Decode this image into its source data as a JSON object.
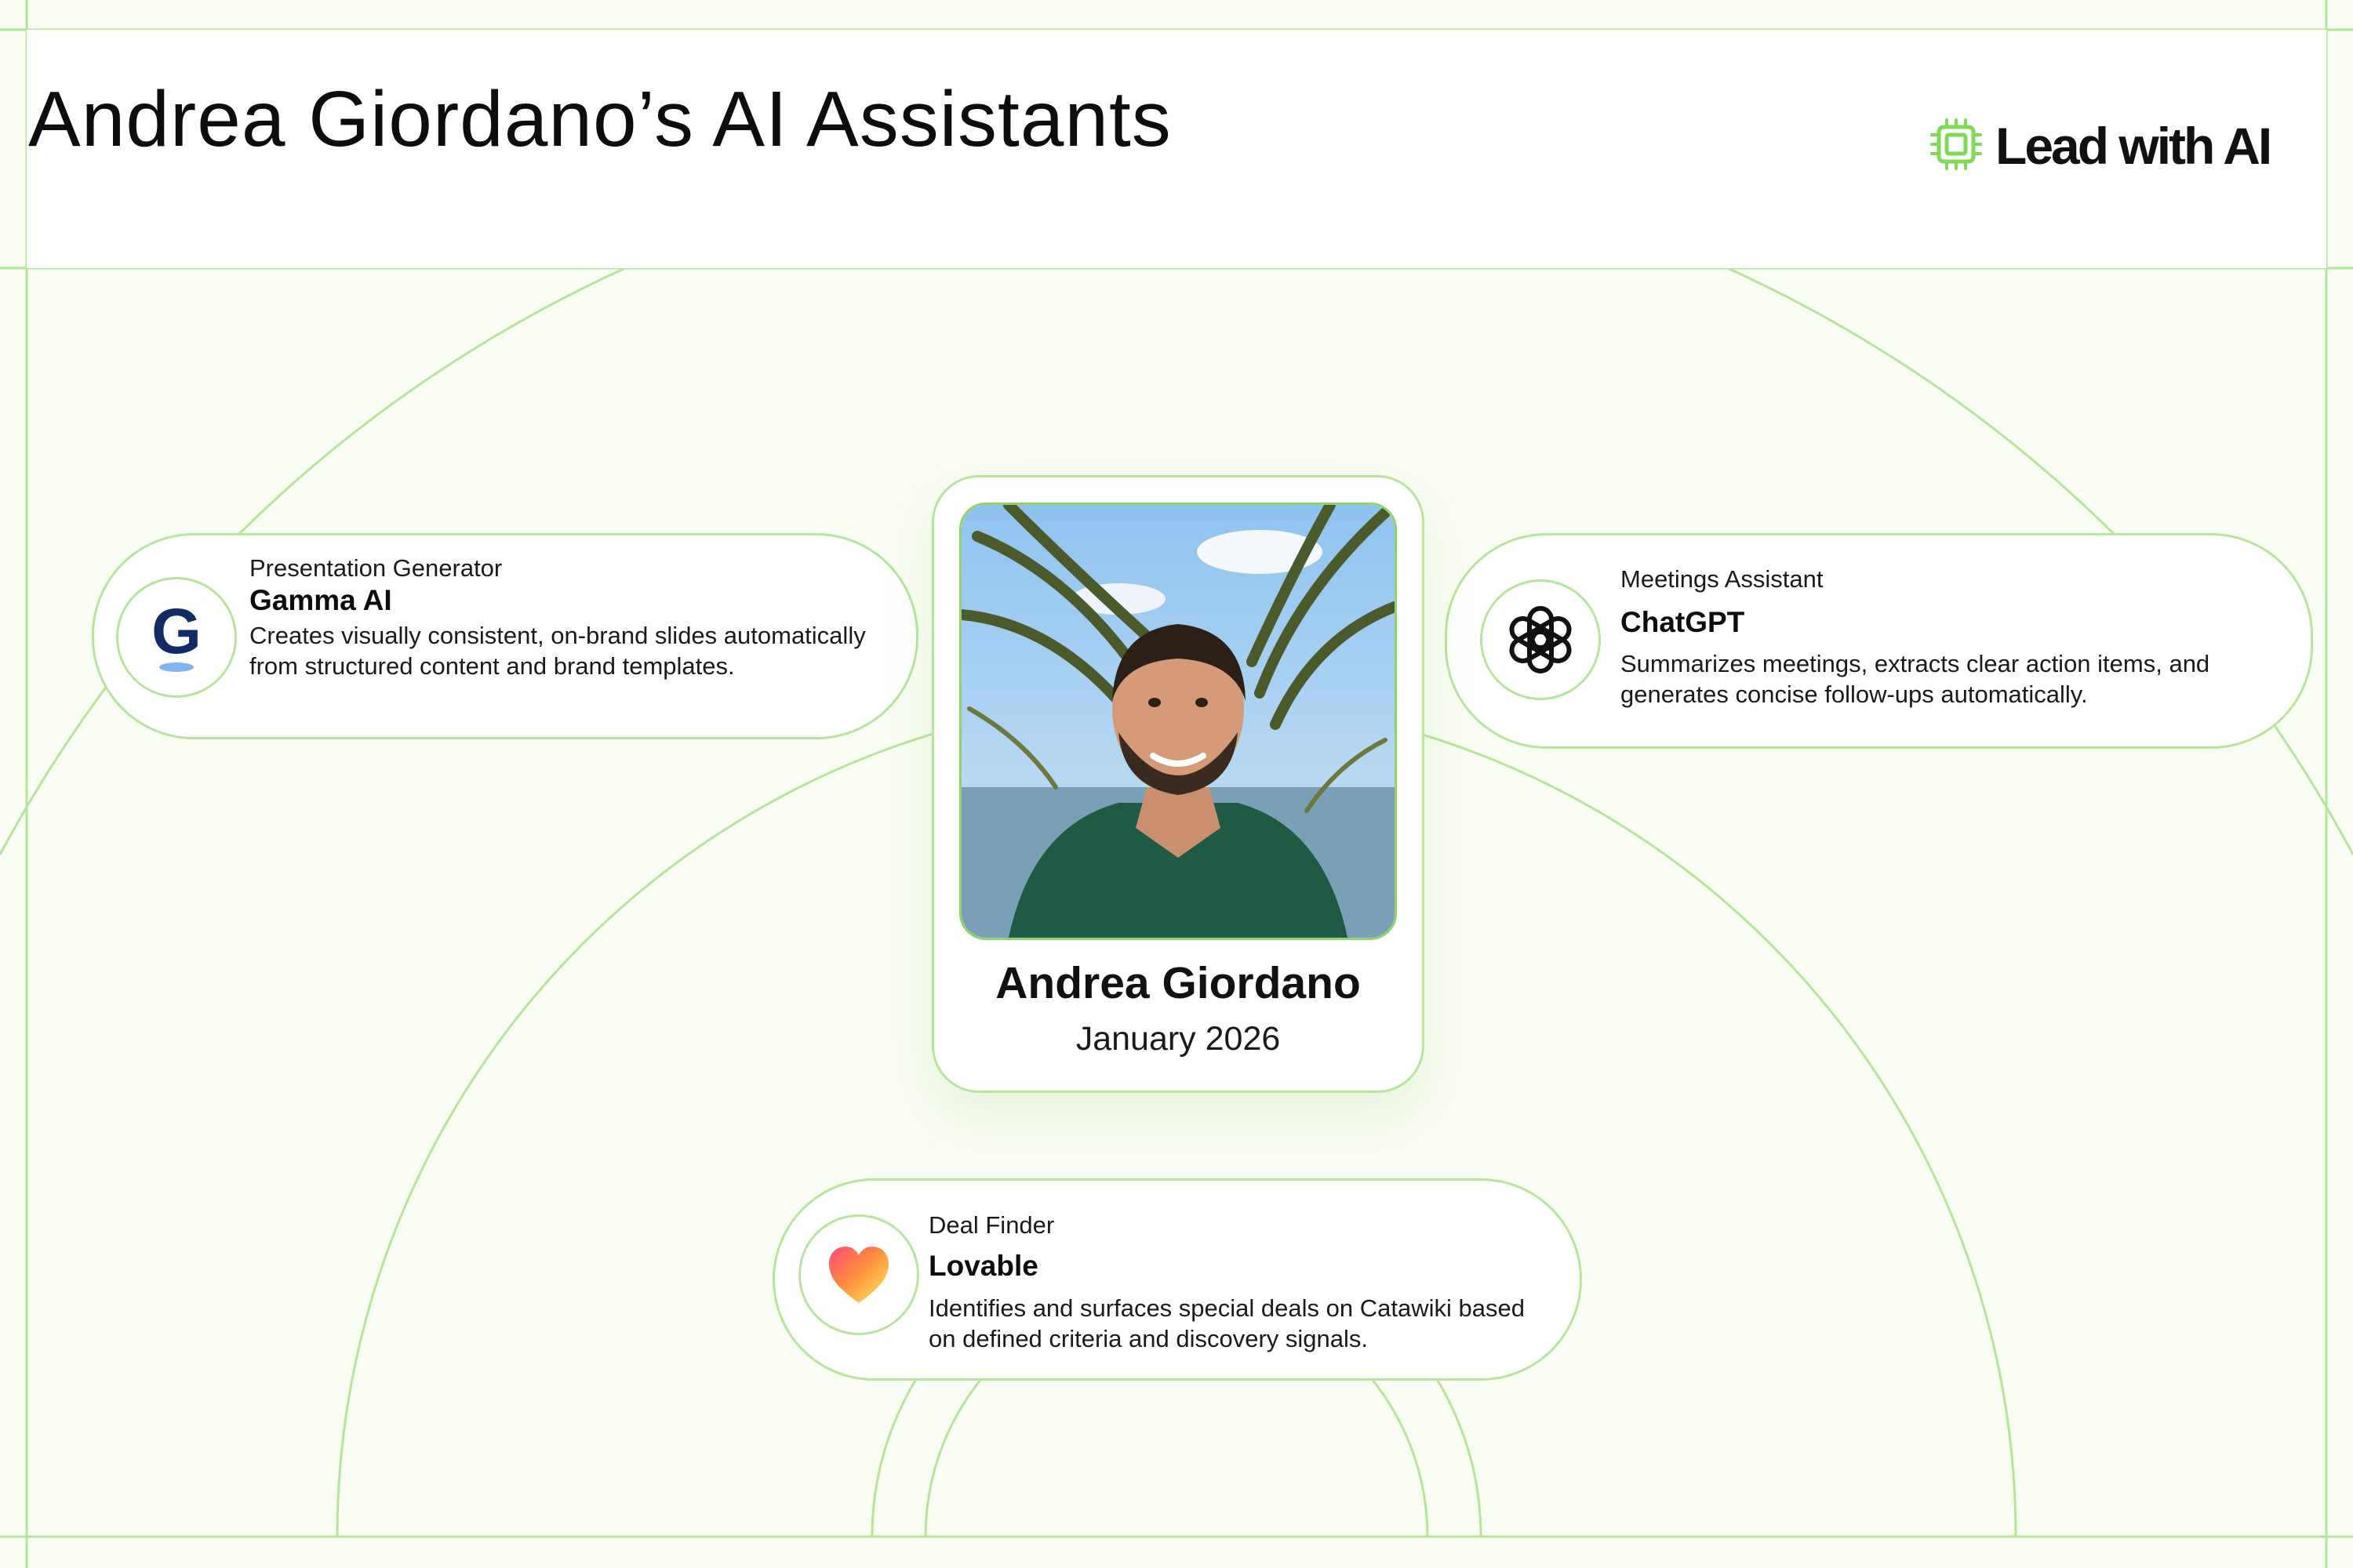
{
  "header": {
    "title": "Andrea Giordano’s AI Assistants"
  },
  "logo": {
    "text": "Lead with AI",
    "icon": "chip-icon"
  },
  "profile": {
    "name": "Andrea Giordano",
    "date": "January 2026"
  },
  "assistants": [
    {
      "role": "Presentation Generator",
      "name": "Gamma AI",
      "description": "Creates visually consistent, on-brand slides automatically from structured content and brand templates.",
      "icon": "gamma-logo-icon"
    },
    {
      "role": "Meetings Assistant",
      "name": "ChatGPT",
      "description": "Summarizes meetings, extracts clear action items, and generates concise follow-ups automatically.",
      "icon": "openai-logo-icon"
    },
    {
      "role": "Deal Finder",
      "name": "Lovable",
      "description": "Identifies and surfaces special deals on Catawiki based on defined criteria and discovery signals.",
      "icon": "lovable-heart-icon"
    }
  ],
  "colors": {
    "background": "#fafdf3",
    "line": "#b5e69b",
    "accent": "#7ed957",
    "text": "#111111"
  }
}
